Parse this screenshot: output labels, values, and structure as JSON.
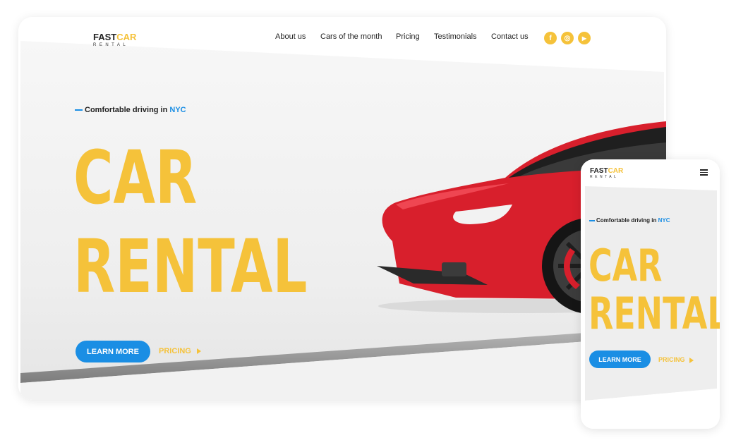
{
  "brand": {
    "logo_fast": "FAST",
    "logo_car": "CAR",
    "logo_sub": "RENTAL"
  },
  "nav": {
    "items": [
      "About us",
      "Cars of the month",
      "Pricing",
      "Testimonials",
      "Contact us"
    ],
    "social": [
      {
        "icon": "facebook-icon",
        "glyph": "f"
      },
      {
        "icon": "instagram-icon",
        "glyph": "◎"
      },
      {
        "icon": "youtube-icon",
        "glyph": "▶"
      }
    ]
  },
  "hero": {
    "eyebrow_text": "Comfortable driving in",
    "eyebrow_city": "NYC",
    "title_line1": "CAR",
    "title_line2": "RENTAL",
    "cta_primary": "LEARN MORE",
    "cta_secondary": "PRICING"
  },
  "colors": {
    "accent_yellow": "#f5c23a",
    "accent_blue": "#1a8ee4",
    "car_red": "#d81f2c"
  },
  "mobile": {
    "menu_icon": "hamburger-menu-icon"
  }
}
